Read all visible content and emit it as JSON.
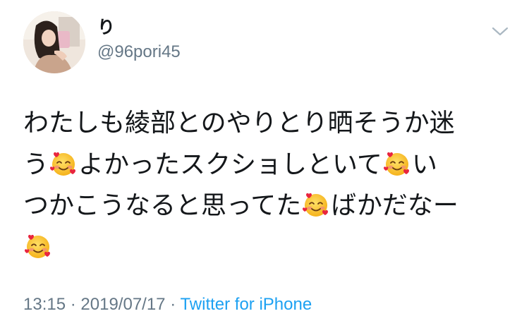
{
  "tweet": {
    "display_name": "り",
    "handle": "@96pori45",
    "lines": [
      [
        "わたしも綾部とのやりとり晒そうか迷"
      ],
      [
        "う",
        "emoji",
        "よかったスクショしといて",
        "emoji",
        "い"
      ],
      [
        "つかこうなると思ってた",
        "emoji",
        "ばかだなー"
      ],
      [
        "emoji"
      ]
    ],
    "emoji_name": "smiling-face-with-hearts",
    "time": "13:15",
    "date": "2019/07/17",
    "separator": "·",
    "source": "Twitter for iPhone"
  },
  "colors": {
    "text": "#14171a",
    "secondary": "#657786",
    "link": "#1da1f2",
    "background": "#ffffff"
  },
  "icons": {
    "menu": "chevron-down-icon",
    "emoji": "smiling-face-with-hearts-emoji"
  }
}
